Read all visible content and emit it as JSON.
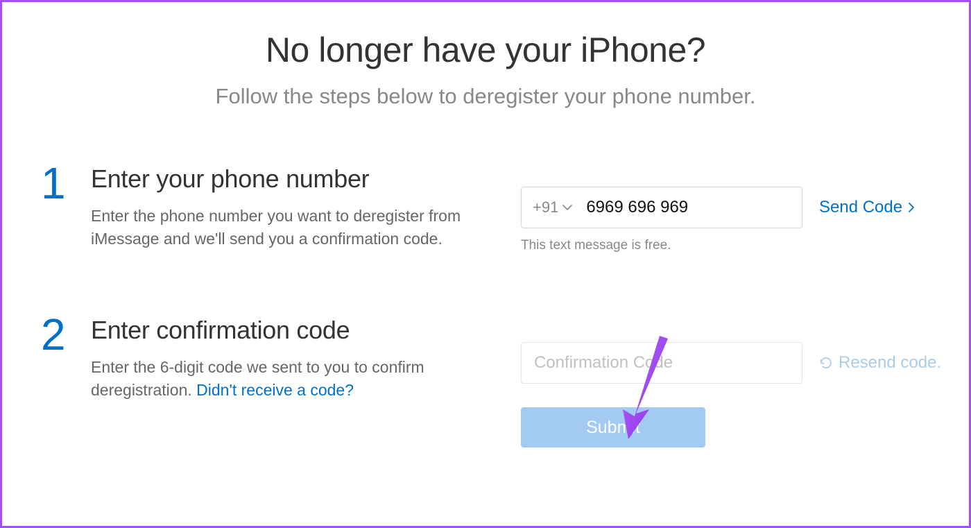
{
  "header": {
    "title": "No longer have your iPhone?",
    "subtitle": "Follow the steps below to deregister your phone number."
  },
  "step1": {
    "num": "1",
    "title": "Enter your phone number",
    "desc": "Enter the phone number you want to deregister from iMessage and we'll send you a confirmation code.",
    "country_code": "+91",
    "phone_value": "6969 696 969",
    "send_label": "Send Code",
    "hint": "This text message is free."
  },
  "step2": {
    "num": "2",
    "title": "Enter confirmation code",
    "desc_prefix": "Enter the 6-digit code we sent to you to confirm deregistration. ",
    "help_link": "Didn't receive a code?",
    "code_placeholder": "Confirmation Code",
    "resend_label": "Resend code.",
    "submit_label": "Submit"
  }
}
